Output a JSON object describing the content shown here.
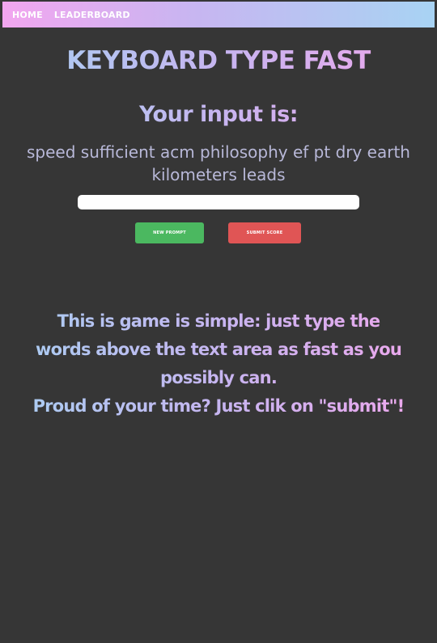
{
  "nav": {
    "home": "HOME",
    "leaderboard": "LEADERBOARD"
  },
  "game": {
    "title": "KEYBOARD TYPE FAST",
    "input_heading": "Your input is:",
    "prompt_words": "speed sufficient acm philosophy ef pt dry earth kilometers leads",
    "typing_input_value": "",
    "new_prompt_label": "NEW PROMPT",
    "submit_label": "SUBMIT SCORE"
  },
  "instructions": {
    "line1": "This is game is simple: just type the",
    "line2": "words above the text area as fast as you",
    "line3": "possibly can.",
    "line4": "Proud of your time? Just clik on \"submit\"!"
  }
}
